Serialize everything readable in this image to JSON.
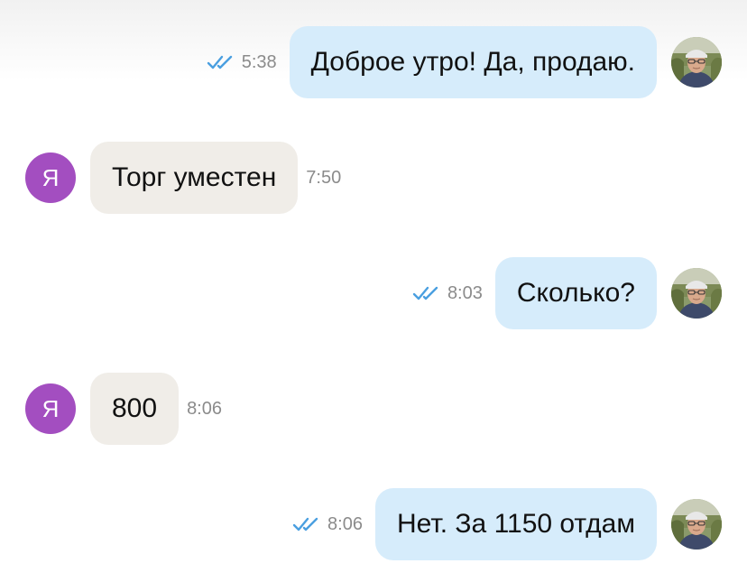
{
  "messages": [
    {
      "direction": "out",
      "text": "Доброе утро! Да, продаю.",
      "time": "5:38",
      "read_status_icon": "double-check-icon"
    },
    {
      "direction": "in",
      "avatar_letter": "Я",
      "text": "Торг уместен",
      "time": "7:50"
    },
    {
      "direction": "out",
      "text": "Сколько?",
      "time": "8:03",
      "read_status_icon": "double-check-icon"
    },
    {
      "direction": "in",
      "avatar_letter": "Я",
      "text": "800",
      "time": "8:06"
    },
    {
      "direction": "out",
      "text": "Нет. За 1150 отдам",
      "time": "8:06",
      "read_status_icon": "double-check-icon"
    }
  ],
  "colors": {
    "outgoing_bubble": "#d6ecfb",
    "incoming_bubble": "#f0ede8",
    "incoming_avatar": "#a34ec0",
    "read_ticks": "#4a9fe0",
    "timestamp": "#8b8b8b"
  }
}
